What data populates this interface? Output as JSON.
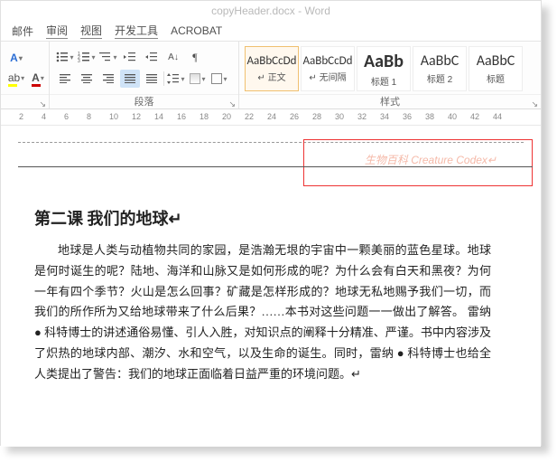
{
  "titlebar": "copyHeader.docx - Word",
  "tabs": {
    "t1": "邮件",
    "t2": "审阅",
    "t3": "视图",
    "t4": "开发工具",
    "t5": "ACROBAT"
  },
  "groups": {
    "paragraph": "段落",
    "styles": "样式"
  },
  "styles": [
    {
      "sample": "AaBbCcDd",
      "name": "↵ 正文",
      "cls": ""
    },
    {
      "sample": "AaBbCcDd",
      "name": "↵ 无间隔",
      "cls": ""
    },
    {
      "sample": "AaBb",
      "name": "标题 1",
      "cls": "big"
    },
    {
      "sample": "AaBbC",
      "name": "标题 2",
      "cls": "med"
    },
    {
      "sample": "AaBbC",
      "name": "标题",
      "cls": "med"
    }
  ],
  "ruler": [
    "2",
    "4",
    "6",
    "8",
    "10",
    "12",
    "14",
    "16",
    "18",
    "20",
    "22",
    "24",
    "26",
    "28",
    "30",
    "32",
    "34",
    "36",
    "38",
    "40",
    "42",
    "44"
  ],
  "doc": {
    "header": "生物百科 Creature Codex↵",
    "title": "第二课  我们的地球↵",
    "para": "地球是人类与动植物共同的家园，是浩瀚无垠的宇宙中一颗美丽的蓝色星球。地球是何时诞生的呢？陆地、海洋和山脉又是如何形成的呢？为什么会有白天和黑夜？为何一年有四个季节？火山是怎么回事？矿藏是怎样形成的？地球无私地赐予我们一切，而我们的所作所为又给地球带来了什么后果？……本书对这些问题一一做出了解答。  雷纳 ● 科特博士的讲述通俗易懂、引人入胜，对知识点的阐释十分精准、严谨。书中内容涉及了炽热的地球内部、潮汐、水和空气，以及生命的诞生。同时，雷纳 ● 科特博士也给全人类提出了警告：我们的地球正面临着日益严重的环境问题。↵"
  }
}
